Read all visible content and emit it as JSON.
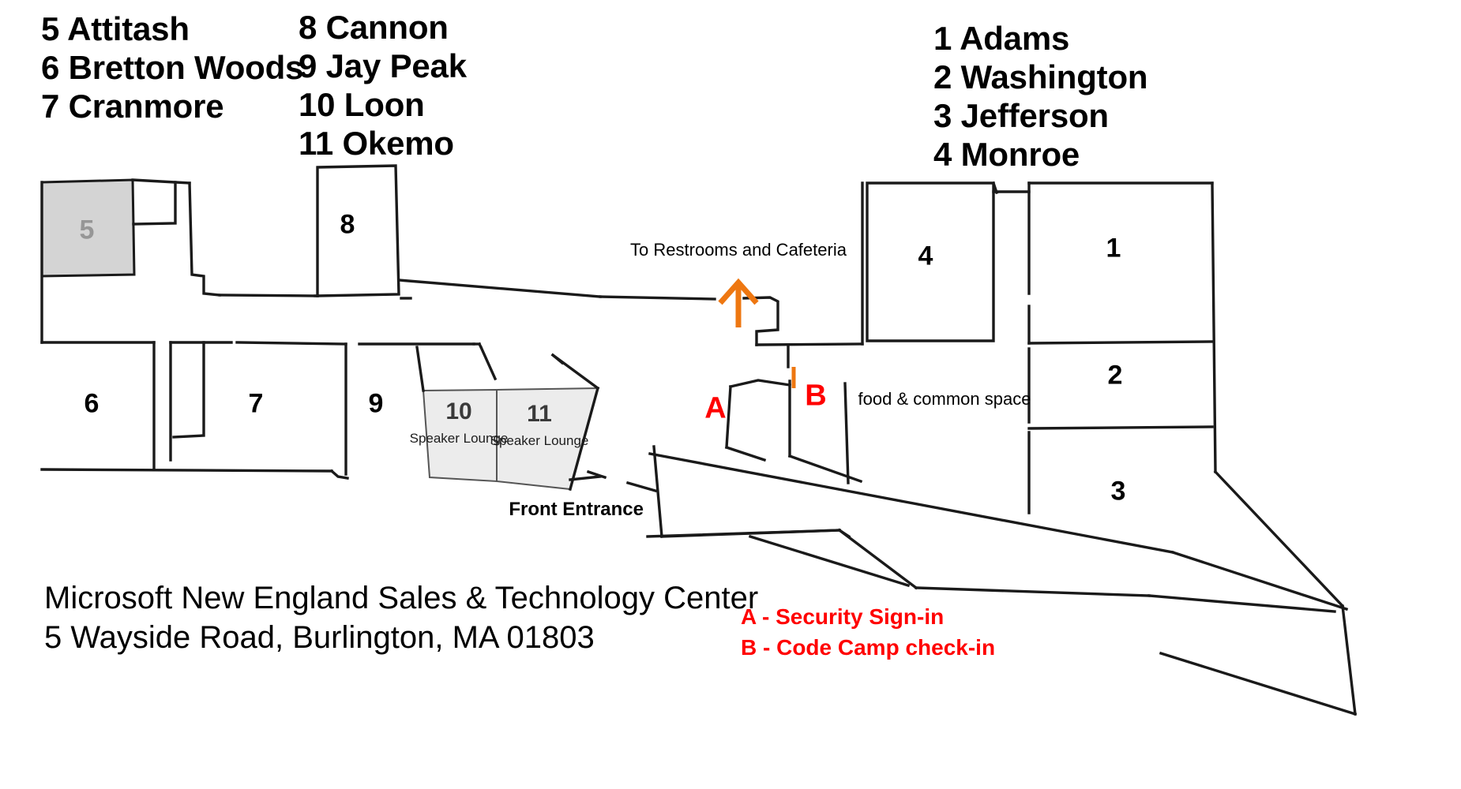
{
  "legends": {
    "left": {
      "lines": [
        "5 Attitash",
        "6 Bretton Woods",
        "7 Cranmore"
      ]
    },
    "middle": {
      "lines": [
        "8 Cannon",
        "9 Jay Peak",
        "10 Loon",
        "11 Okemo"
      ]
    },
    "right": {
      "lines": [
        "1 Adams",
        "2 Washington",
        "3 Jefferson",
        "4 Monroe"
      ]
    }
  },
  "rooms": [
    {
      "id": "5",
      "label": "5",
      "sub": ""
    },
    {
      "id": "6",
      "label": "6",
      "sub": ""
    },
    {
      "id": "7",
      "label": "7",
      "sub": ""
    },
    {
      "id": "8",
      "label": "8",
      "sub": ""
    },
    {
      "id": "9",
      "label": "9",
      "sub": ""
    },
    {
      "id": "10",
      "label": "10",
      "sub": "Speaker\nLounge"
    },
    {
      "id": "11",
      "label": "11",
      "sub": "Speaker\nLounge"
    },
    {
      "id": "1",
      "label": "1",
      "sub": ""
    },
    {
      "id": "2",
      "label": "2",
      "sub": ""
    },
    {
      "id": "3",
      "label": "3",
      "sub": ""
    },
    {
      "id": "4",
      "label": "4",
      "sub": ""
    }
  ],
  "annotations": {
    "restrooms": "To\nRestrooms and\nCafeteria",
    "food_common": "food &\ncommon space",
    "front_entrance": "Front\nEntrance",
    "marker_a": "A",
    "marker_b": "B"
  },
  "caption": {
    "lines": [
      "Microsoft New England Sales & Technology Center",
      "5 Wayside Road, Burlington, MA 01803"
    ]
  },
  "key": {
    "lines": [
      "A - Security Sign-in",
      "B - Code Camp check-in"
    ]
  },
  "colors": {
    "wall": "#1a1a1a",
    "room5_fill": "#d4d4d4",
    "lounge_fill": "#ececec",
    "arrow": "#ee7711",
    "marker": "#ff0000",
    "background": "#ffffff"
  }
}
